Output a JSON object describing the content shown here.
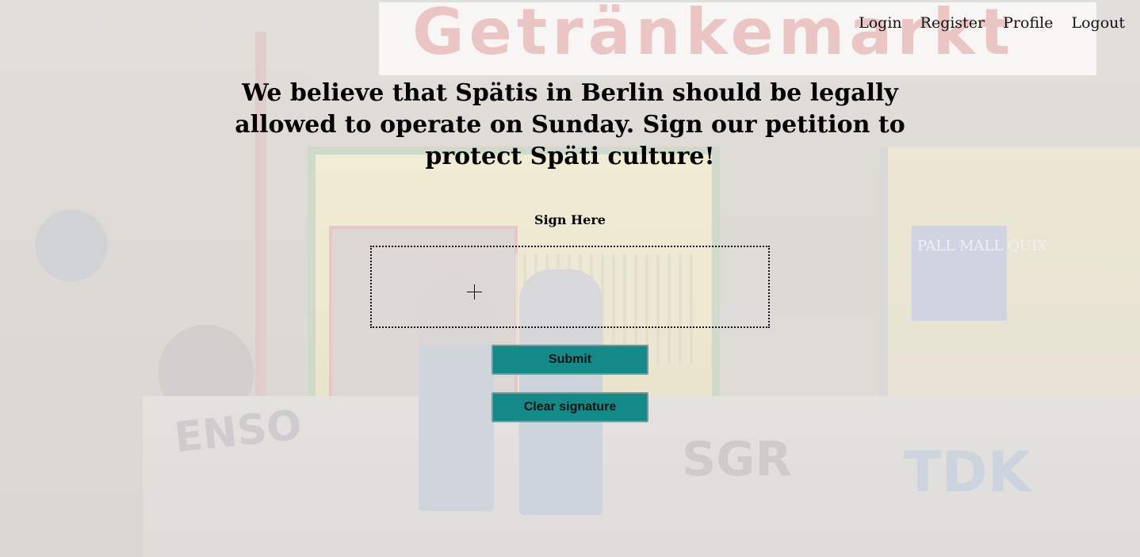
{
  "background": {
    "storefront_sign_text": "Getränkemarkt",
    "cigarette_sign_text": "PALL MALL QUIX",
    "graffiti_texts": [
      "ENSO",
      "SGR",
      "TDK"
    ]
  },
  "nav": {
    "items": [
      {
        "label": "Login"
      },
      {
        "label": "Register"
      },
      {
        "label": "Profile"
      },
      {
        "label": "Logout"
      }
    ]
  },
  "main": {
    "headline": "We believe that Spätis in Berlin should be legally allowed to operate on Sunday. Sign our petition to protect Späti culture!",
    "sign_label": "Sign Here",
    "cursor_icon": "crosshair-icon",
    "submit_label": "Submit",
    "clear_label": "Clear signature"
  },
  "colors": {
    "button_bg": "#138a87",
    "text": "#111111"
  }
}
